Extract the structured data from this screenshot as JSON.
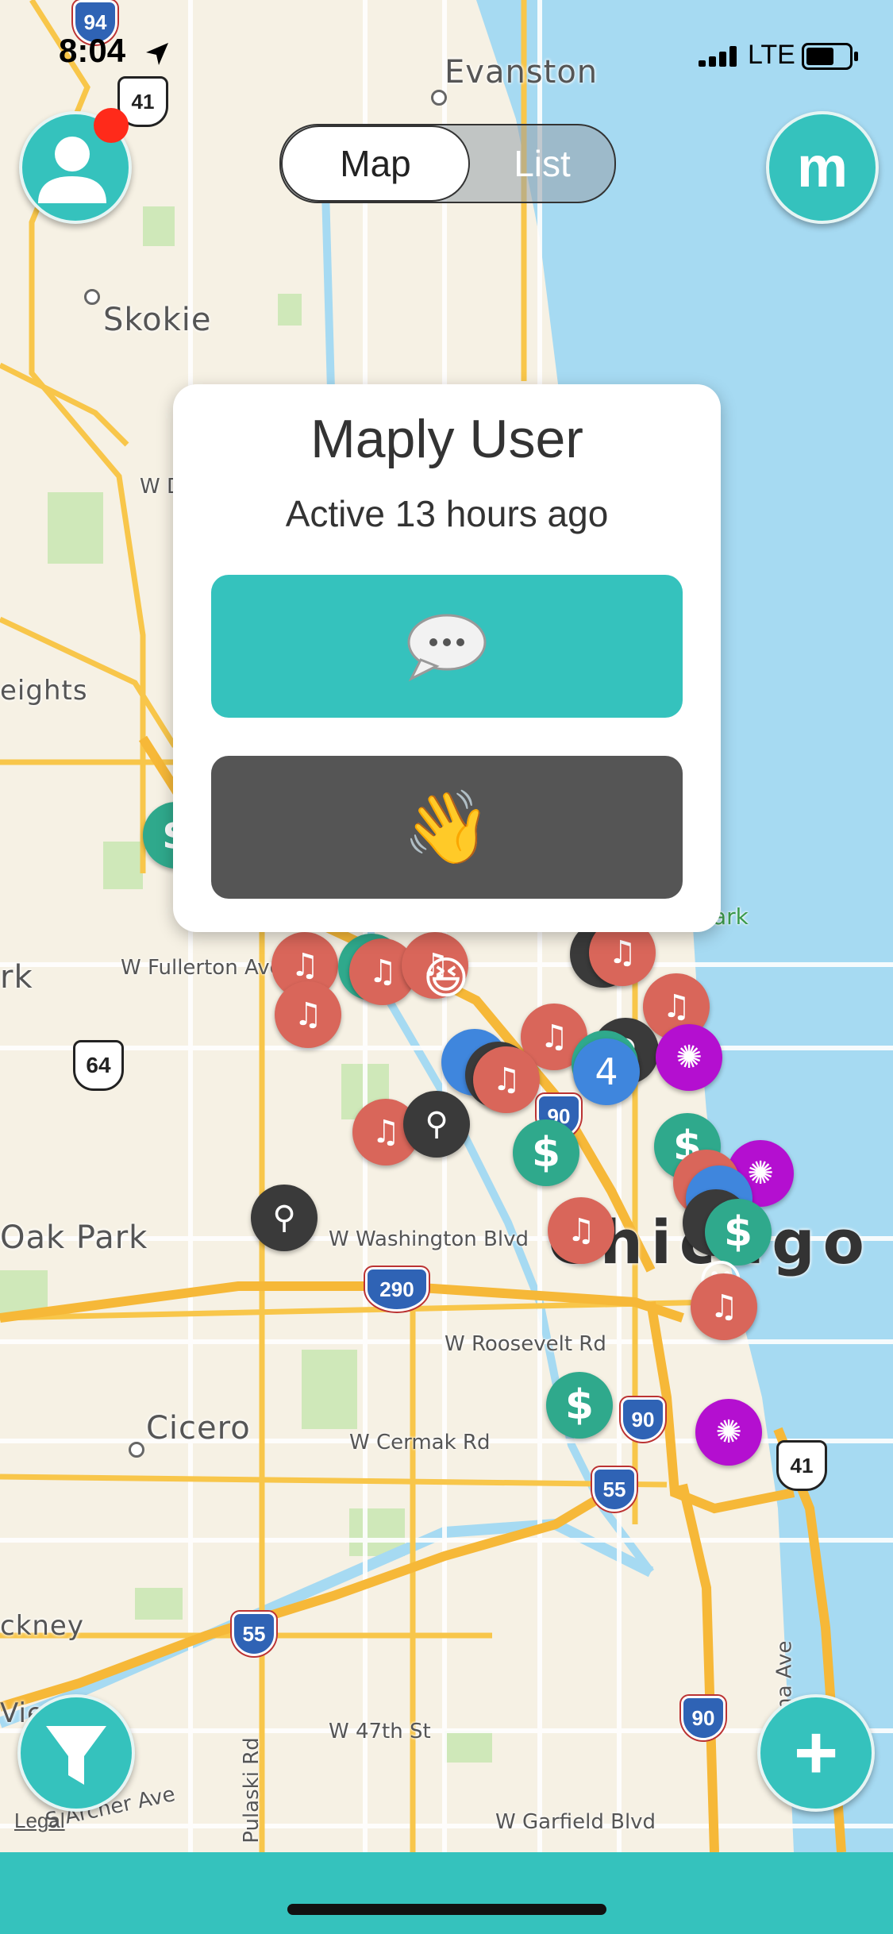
{
  "status_bar": {
    "time": "8:04",
    "network": "LTE"
  },
  "header": {
    "toggle_map": "Map",
    "toggle_list": "List",
    "logo_letter": "m"
  },
  "map_labels": {
    "places": [
      "Evanston",
      "Skokie",
      "eights",
      "rk",
      "Oak Park",
      "Cicero",
      "ckney",
      "Vie"
    ],
    "city_big": "Chicago",
    "streets": [
      "W D",
      "W Fullerton Ave",
      "W Washington Blvd",
      "W Roosevelt Rd",
      "W Cermak Rd",
      "W 47th St",
      "W Garfield Blvd",
      "S Archer Ave",
      "Pulaski Rd",
      "S Indiana Ave",
      "ark"
    ],
    "shields": [
      "94",
      "41",
      "64",
      "290",
      "90",
      "90",
      "55",
      "55",
      "90",
      "41"
    ],
    "cluster_count": "4"
  },
  "popup": {
    "user_name": "Maply User",
    "last_active": "Active 13 hours ago",
    "chat_emoji": "💬",
    "wave_emoji": "👋"
  },
  "footer": {
    "legal": "Legal",
    "plus": "+"
  },
  "colors": {
    "accent": "#35c2bd",
    "music_pin": "#d9665a",
    "money_pin": "#2fa98c",
    "search_pin": "#3a3a3a",
    "disco_pin": "#b40fd0",
    "cluster_pin": "#3f86dd",
    "water": "#a6daf2"
  }
}
